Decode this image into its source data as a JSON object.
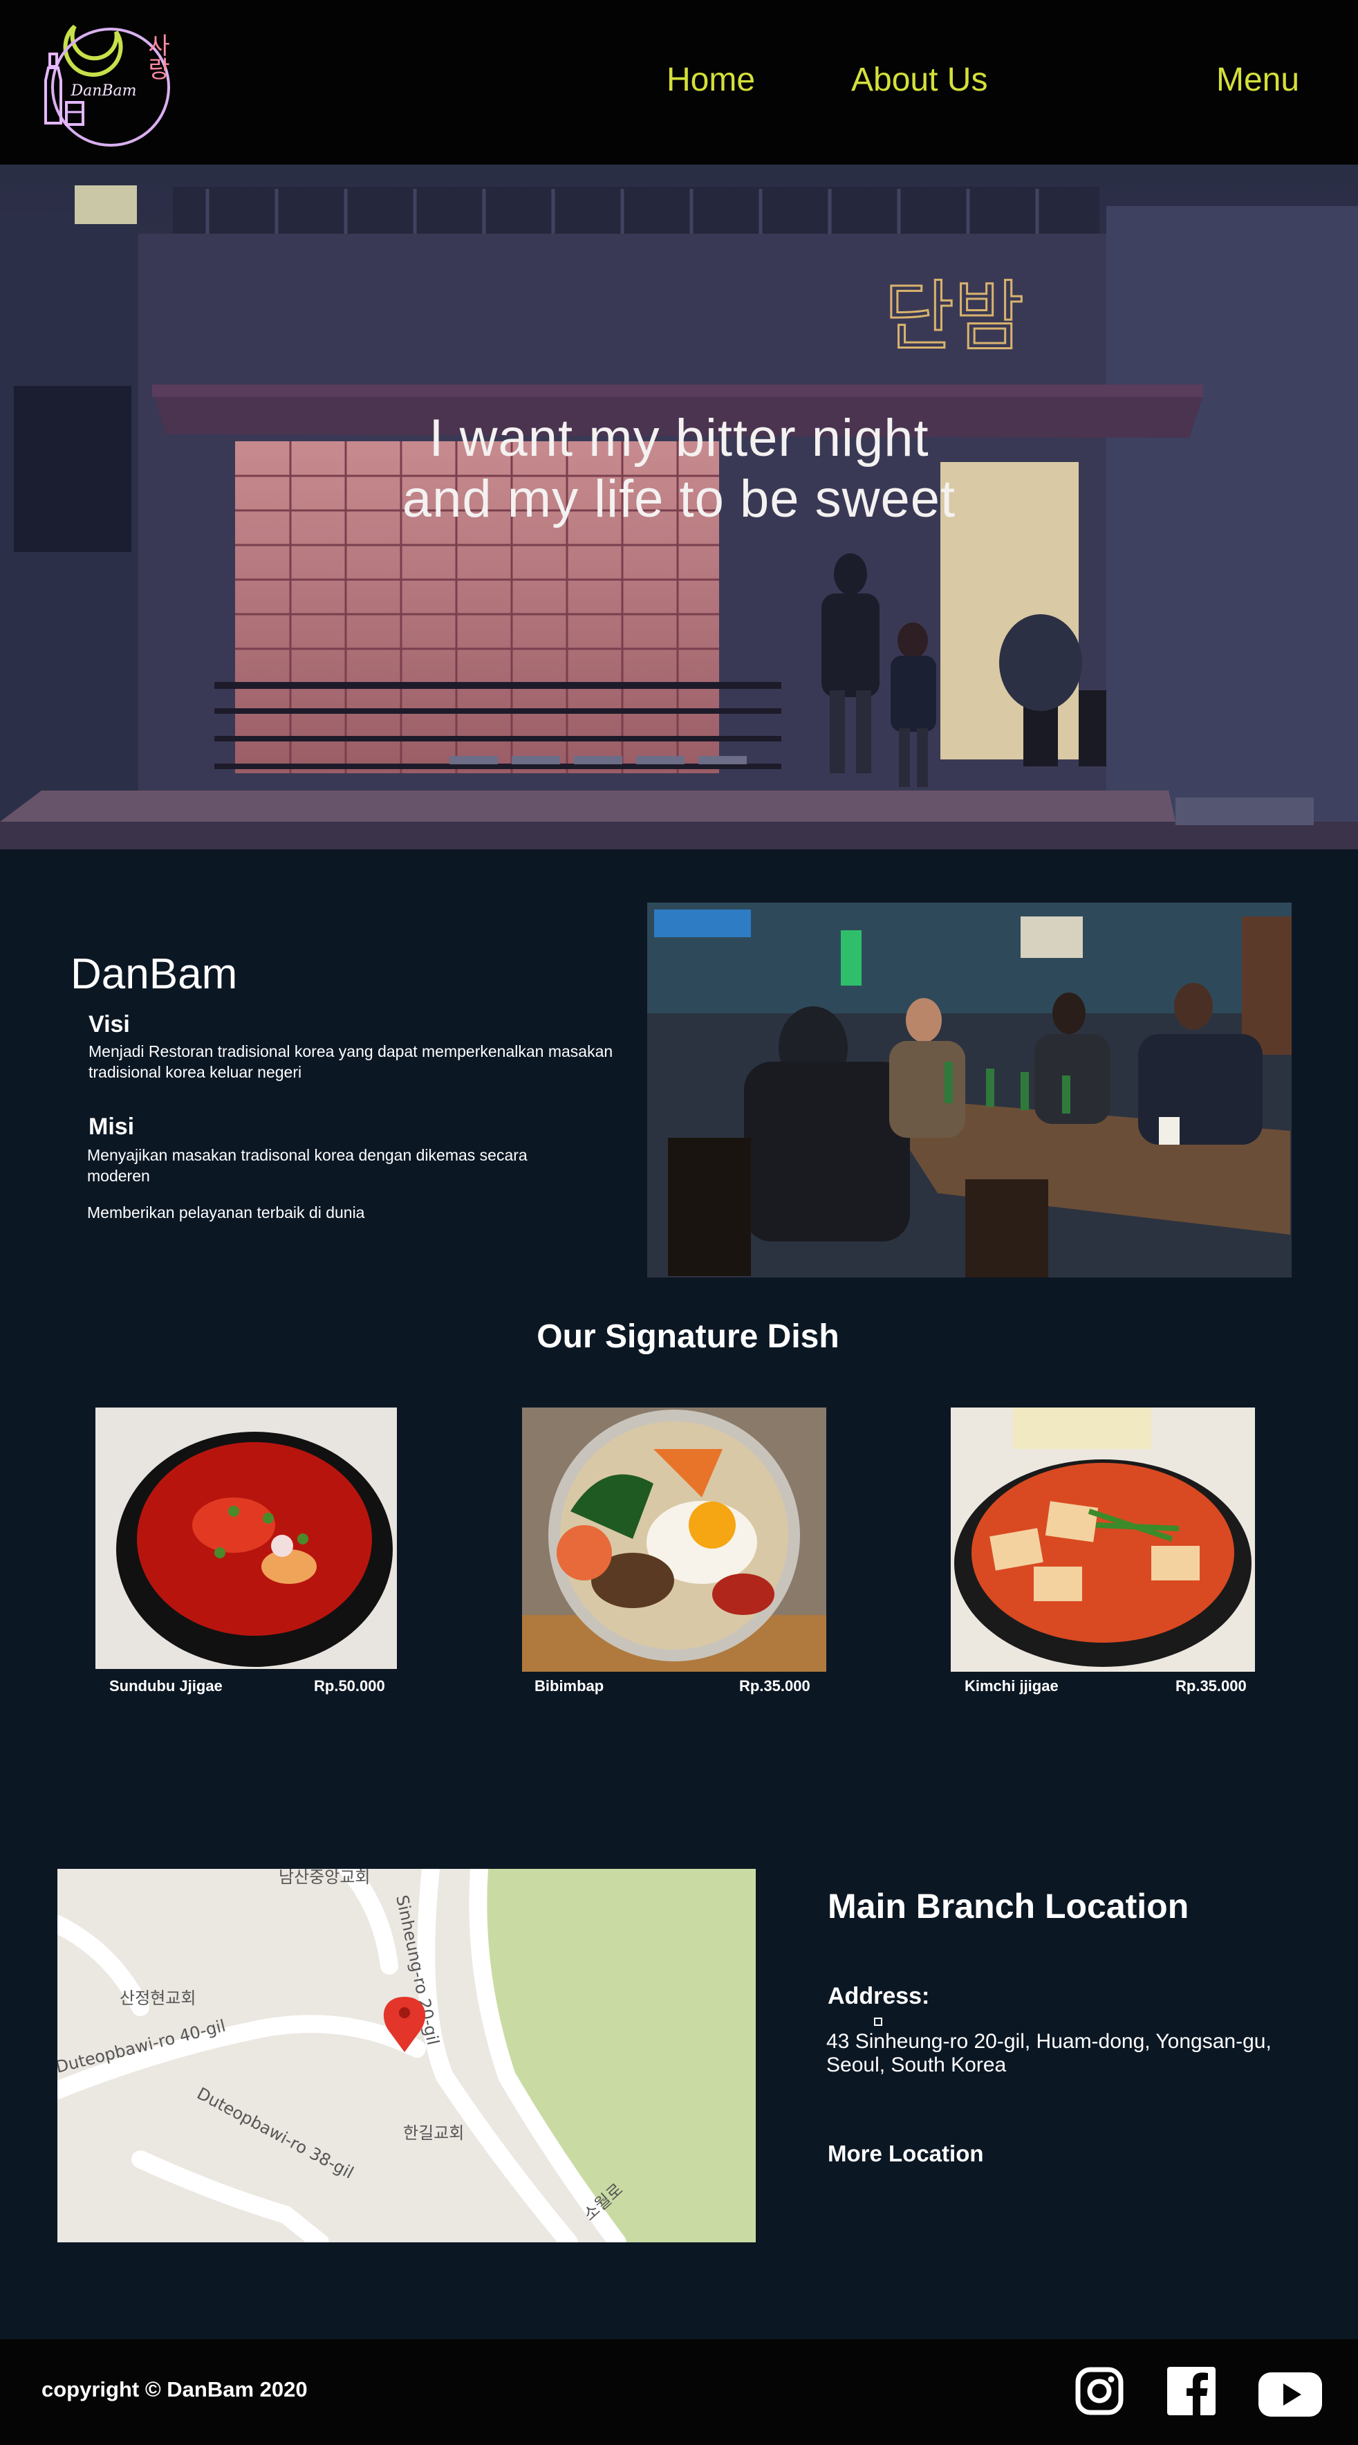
{
  "brand": {
    "logo_text": "DanBam",
    "logo_korean": "사랑"
  },
  "nav": {
    "home": "Home",
    "about": "About Us",
    "menu": "Menu"
  },
  "hero": {
    "sign": "단밤",
    "line1": "I want my bitter night",
    "line2": "and my life to be sweet"
  },
  "about": {
    "title": "DanBam",
    "visi_title": "Visi",
    "visi_text": "Menjadi Restoran tradisional korea yang dapat memperkenalkan masakan tradisional korea keluar negeri",
    "misi_title": "Misi",
    "misi_text1": "Menyajikan masakan tradisonal korea dengan dikemas secara moderen",
    "misi_text2": "Memberikan pelayanan terbaik di dunia"
  },
  "signature": {
    "title": "Our Signature Dish",
    "dishes": [
      {
        "name": "Sundubu Jjigae",
        "price": "Rp.50.000"
      },
      {
        "name": "Bibimbap",
        "price": "Rp.35.000"
      },
      {
        "name": "Kimchi jjigae",
        "price": "Rp.35.000"
      }
    ]
  },
  "location": {
    "title": "Main Branch Location",
    "address_label": "Address:",
    "address_text": "43 Sinheung-ro 20-gil, Huam-dong, Yongsan-gu, Seoul, South Korea",
    "more": "More Location",
    "map_labels": [
      "산정현교회",
      "Duteopbawi-ro 40-gil",
      "Duteopbawi-ro 38-gil",
      "Sinheung-ro 20-gil",
      "한길교회",
      "소월로",
      "남산중앙교회"
    ]
  },
  "footer": {
    "copyright": "copyright © DanBam 2020",
    "social": [
      "instagram-icon",
      "facebook-icon",
      "youtube-icon"
    ]
  },
  "colors": {
    "nav_text": "#d4e03a",
    "page_bg": "#0c1724",
    "header_bg": "#030303"
  }
}
